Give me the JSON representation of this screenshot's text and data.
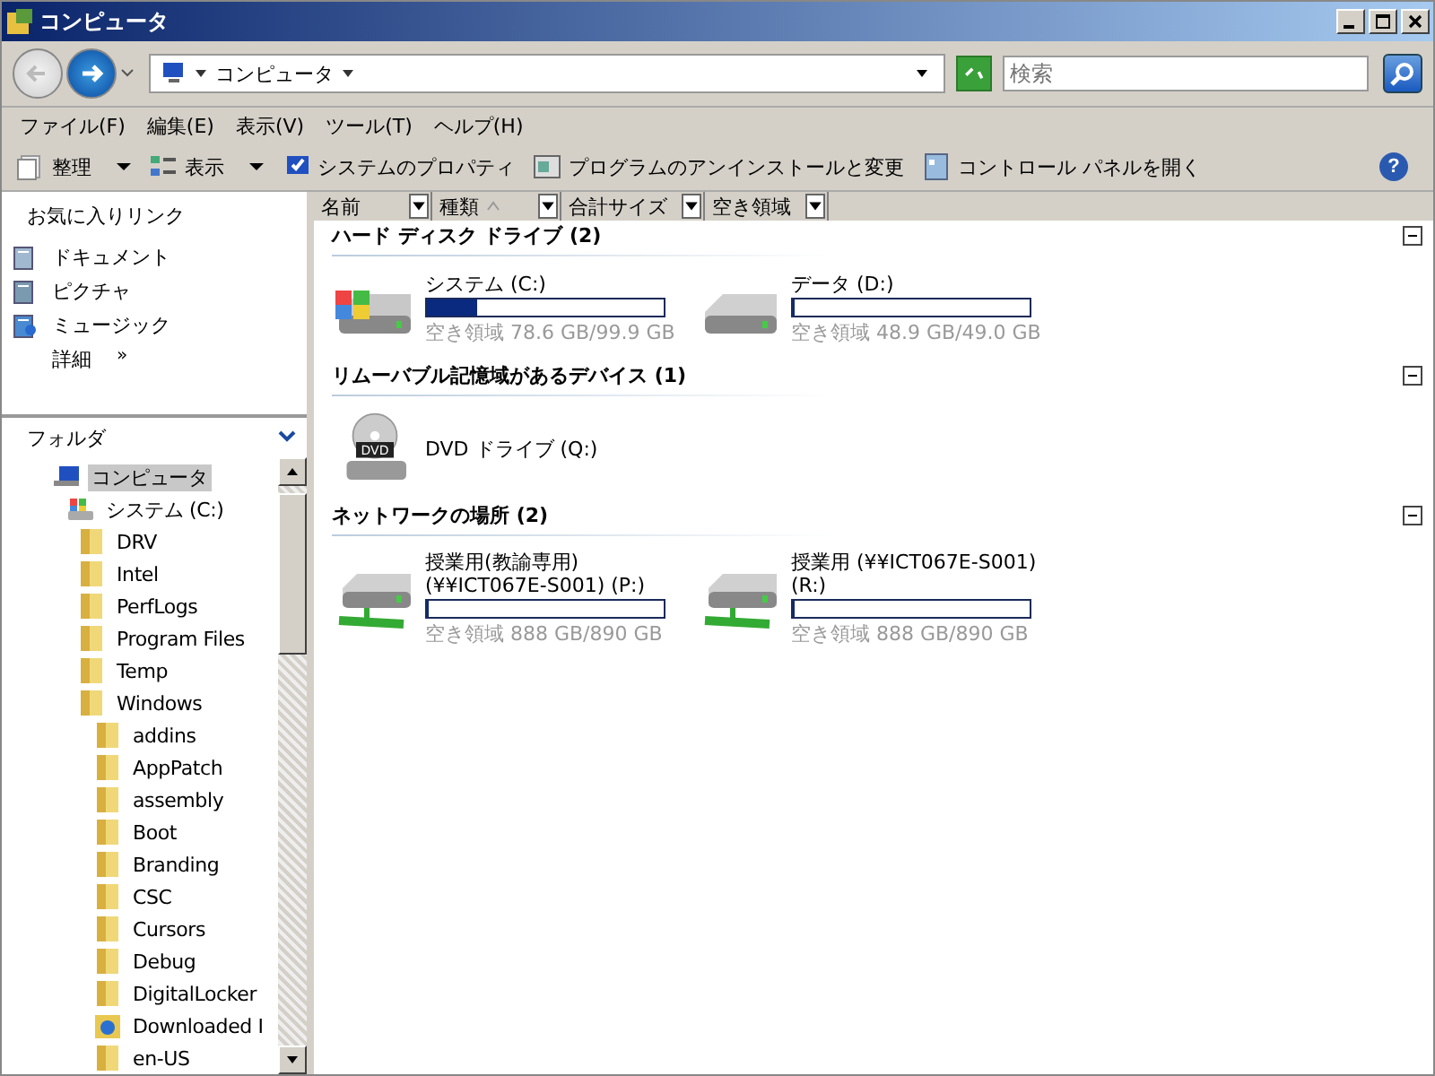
{
  "window": {
    "title": "コンピュータ"
  },
  "address": {
    "path": "コンピュータ"
  },
  "search": {
    "placeholder": "検索"
  },
  "help": {
    "glyph": "?"
  },
  "menu": [
    "ファイル(F)",
    "編集(E)",
    "表示(V)",
    "ツール(T)",
    "ヘルプ(H)"
  ],
  "toolbar": [
    {
      "label": "整理",
      "kind": "organize",
      "dropdown": true
    },
    {
      "label": "表示",
      "kind": "views",
      "dropdown": true
    },
    {
      "label": "システムのプロパティ",
      "kind": "properties",
      "dropdown": false
    },
    {
      "label": "プログラムのアンインストールと変更",
      "kind": "programs",
      "dropdown": false
    },
    {
      "label": "コントロール パネルを開く",
      "kind": "control",
      "dropdown": false
    }
  ],
  "favorites": {
    "title": "お気に入りリンク",
    "items": [
      {
        "label": "ドキュメント",
        "kind": "documents"
      },
      {
        "label": "ピクチャ",
        "kind": "pictures"
      },
      {
        "label": "ミュージック",
        "kind": "music"
      }
    ],
    "more": "詳細",
    "more_glyph": "»"
  },
  "folders": {
    "title": "フォルダ",
    "tree": [
      {
        "label": "コンピュータ",
        "kind": "computer",
        "selected": true,
        "children": [
          {
            "label": "システム (C:)",
            "kind": "drive",
            "selected": false,
            "children": [
              {
                "label": "DRV",
                "kind": "folder",
                "selected": false
              },
              {
                "label": "Intel",
                "kind": "folder",
                "selected": false
              },
              {
                "label": "PerfLogs",
                "kind": "folder",
                "selected": false
              },
              {
                "label": "Program Files",
                "kind": "folder",
                "selected": false
              },
              {
                "label": "Temp",
                "kind": "folder",
                "selected": false
              },
              {
                "label": "Windows",
                "kind": "folder",
                "selected": false,
                "children": [
                  {
                    "label": "addins",
                    "kind": "folder",
                    "selected": false
                  },
                  {
                    "label": "AppPatch",
                    "kind": "folder",
                    "selected": false
                  },
                  {
                    "label": "assembly",
                    "kind": "folder",
                    "selected": false
                  },
                  {
                    "label": "Boot",
                    "kind": "folder",
                    "selected": false
                  },
                  {
                    "label": "Branding",
                    "kind": "folder",
                    "selected": false
                  },
                  {
                    "label": "CSC",
                    "kind": "folder",
                    "selected": false
                  },
                  {
                    "label": "Cursors",
                    "kind": "folder",
                    "selected": false
                  },
                  {
                    "label": "Debug",
                    "kind": "folder",
                    "selected": false
                  },
                  {
                    "label": "DigitalLocker",
                    "kind": "folder",
                    "selected": false
                  },
                  {
                    "label": "Downloaded I",
                    "kind": "web-folder",
                    "selected": false
                  },
                  {
                    "label": "en-US",
                    "kind": "folder",
                    "selected": false
                  }
                ]
              }
            ]
          }
        ]
      }
    ]
  },
  "columns": [
    {
      "label": "名前",
      "sorted": false
    },
    {
      "label": "種類",
      "sorted": true
    },
    {
      "label": "合計サイズ",
      "sorted": false
    },
    {
      "label": "空き領域",
      "sorted": false
    }
  ],
  "groups": [
    {
      "title": "ハード ディスク ドライブ (2)",
      "items": [
        {
          "name": "システム (C:)",
          "kind": "hdd-windows",
          "level": 0.21,
          "free": "空き領域 78.6 GB/99.9 GB"
        },
        {
          "name": "データ (D:)",
          "kind": "hdd",
          "level": 0.002,
          "free": "空き領域 48.9 GB/49.0 GB"
        }
      ]
    },
    {
      "title": "リムーバブル記憶域があるデバイス (1)",
      "items": [
        {
          "name": "DVD ドライブ (Q:)",
          "kind": "dvd",
          "disc_label": "DVD"
        }
      ]
    },
    {
      "title": "ネットワークの場所 (2)",
      "items": [
        {
          "name": "授業用(教諭専用)\n(¥¥ICT067E-S001) (P:)",
          "kind": "network",
          "level": 0.002,
          "free": "空き領域 888 GB/890 GB"
        },
        {
          "name": "授業用 (¥¥ICT067E-S001)\n(R:)",
          "kind": "network",
          "level": 0.002,
          "free": "空き領域 888 GB/890 GB"
        }
      ]
    }
  ]
}
